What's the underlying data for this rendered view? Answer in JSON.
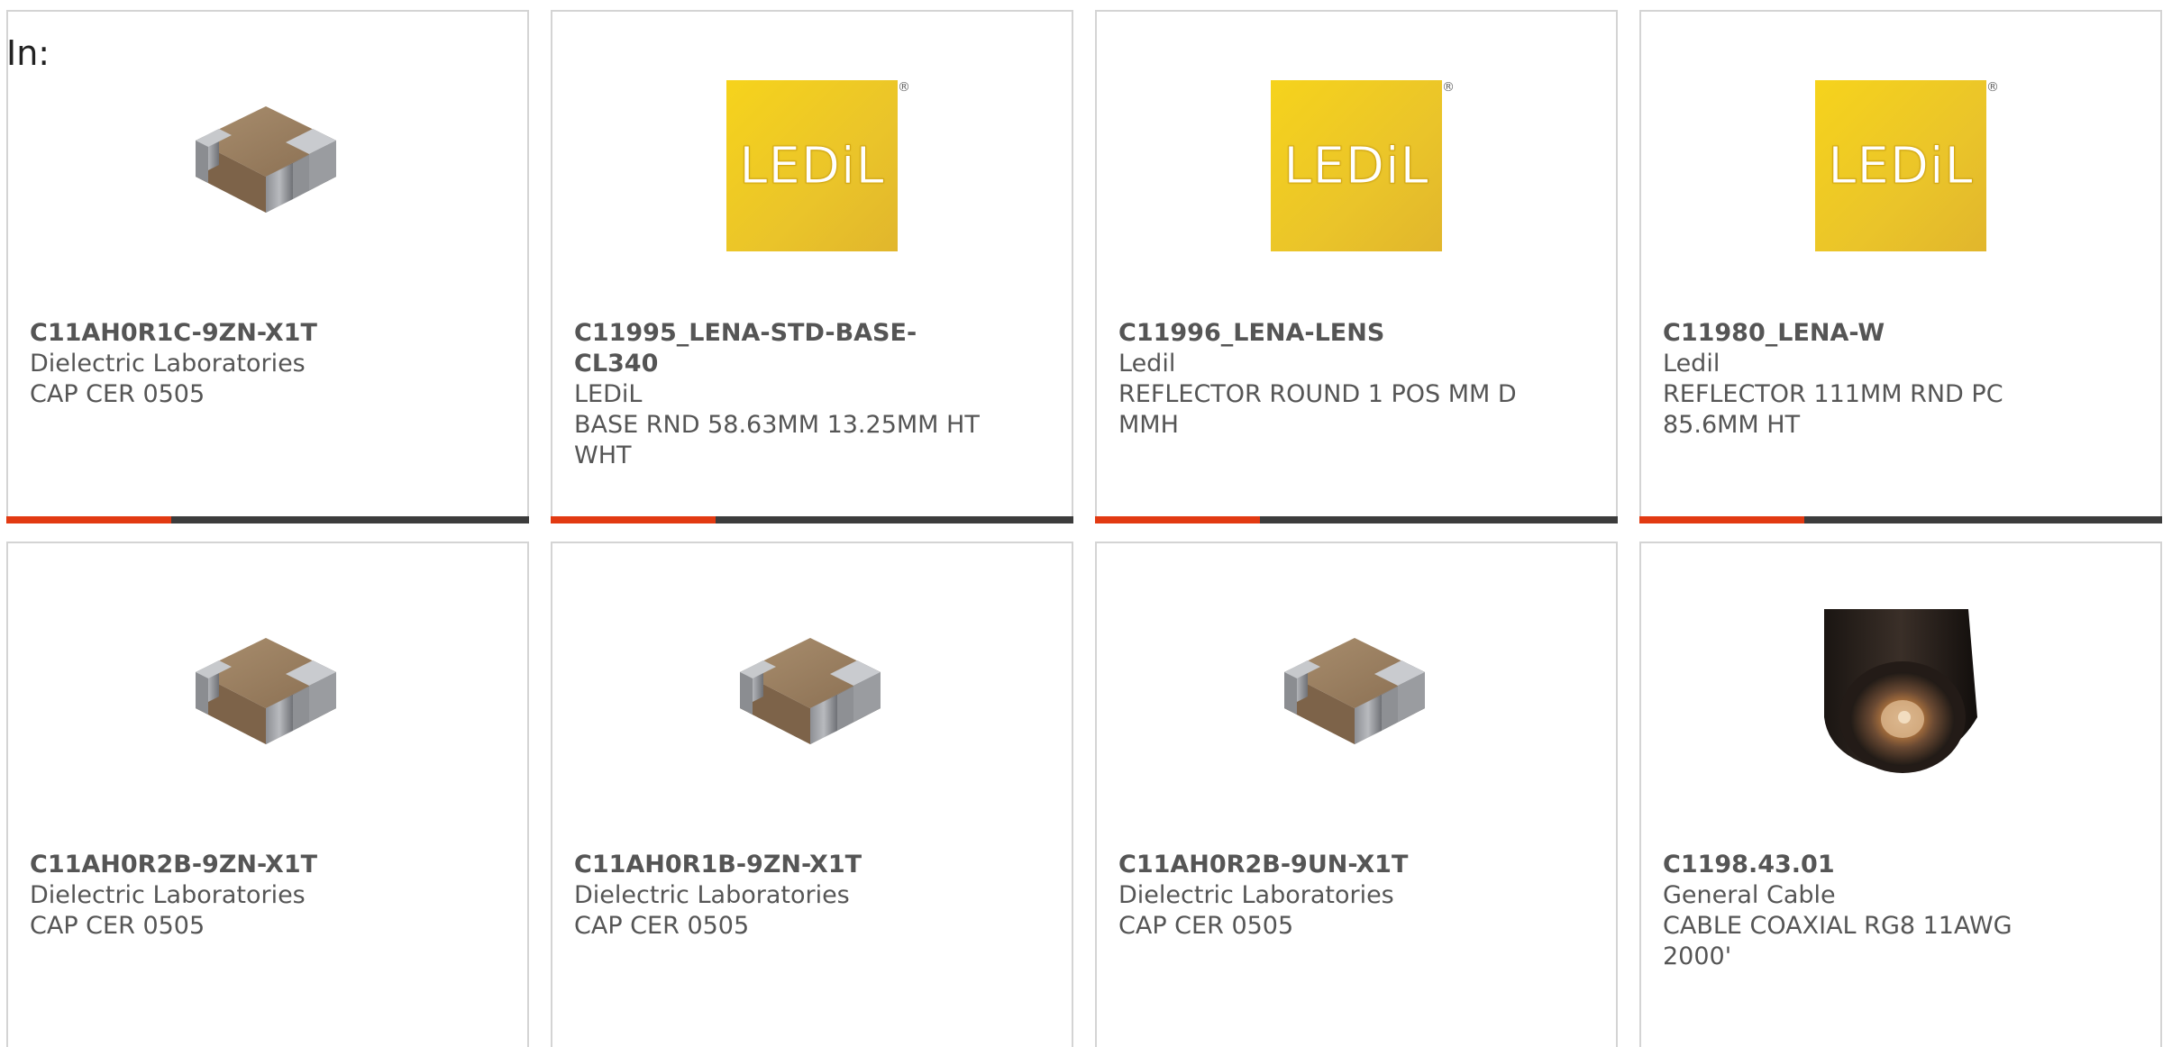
{
  "page": {
    "in_label": "In:"
  },
  "colors": {
    "accent": "#e23a12",
    "bar": "#3c3c3c",
    "border": "#d4d4d4",
    "text": "#555555",
    "ledil_yellow": "#f2cb1d"
  },
  "products": [
    {
      "part_number": "C11AH0R1C-9ZN-X1T",
      "manufacturer": "Dielectric Laboratories",
      "description": "CAP CER 0505",
      "image": "ceramic-capacitor-chip"
    },
    {
      "part_number": "C11995_LENA-STD-BASE-CL340",
      "manufacturer": "LEDiL",
      "description": "BASE RND 58.63MM 13.25MM HT WHT",
      "image": "ledil-logo",
      "logo_text": "LEDiL",
      "logo_mark": "®"
    },
    {
      "part_number": "C11996_LENA-LENS",
      "manufacturer": "Ledil",
      "description": "REFLECTOR ROUND 1 POS MM D MMH",
      "image": "ledil-logo",
      "logo_text": "LEDiL",
      "logo_mark": "®"
    },
    {
      "part_number": "C11980_LENA-W",
      "manufacturer": "Ledil",
      "description": "REFLECTOR 111MM RND PC 85.6MM HT",
      "image": "ledil-logo",
      "logo_text": "LEDiL",
      "logo_mark": "®"
    },
    {
      "part_number": "C11AH0R2B-9ZN-X1T",
      "manufacturer": "Dielectric Laboratories",
      "description": "CAP CER 0505",
      "image": "ceramic-capacitor-chip"
    },
    {
      "part_number": "C11AH0R1B-9ZN-X1T",
      "manufacturer": "Dielectric Laboratories",
      "description": "CAP CER 0505",
      "image": "ceramic-capacitor-chip"
    },
    {
      "part_number": "C11AH0R2B-9UN-X1T",
      "manufacturer": "Dielectric Laboratories",
      "description": "CAP CER 0505",
      "image": "ceramic-capacitor-chip"
    },
    {
      "part_number": "C1198.43.01",
      "manufacturer": "General Cable",
      "description": "CABLE COAXIAL RG8 11AWG 2000'",
      "image": "coaxial-cable"
    }
  ]
}
